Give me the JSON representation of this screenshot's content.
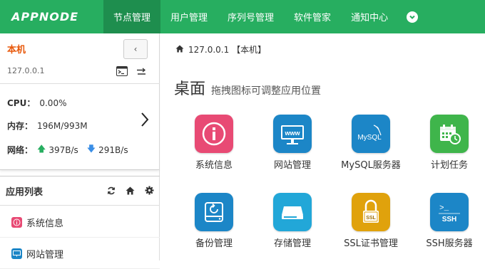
{
  "brand": "APPNODE",
  "nav": {
    "items": [
      "节点管理",
      "用户管理",
      "序列号管理",
      "软件管家",
      "通知中心"
    ],
    "active_index": 0
  },
  "sidebar": {
    "host_name": "本机",
    "host_ip": "127.0.0.1",
    "collapse_symbol": "‹",
    "cpu_label": "CPU：",
    "cpu_value": "0.00%",
    "mem_label": "内存：",
    "mem_value": "196M/993M",
    "net_label": "网络：",
    "net_up": "397B/s",
    "net_down": "291B/s",
    "app_list_title": "应用列表",
    "apps": [
      {
        "label": "系统信息",
        "icon": "info-icon",
        "color": "#e84a74"
      },
      {
        "label": "网站管理",
        "icon": "www-icon",
        "color": "#1c86c7"
      }
    ]
  },
  "main": {
    "breadcrumb_host": "127.0.0.1 【本机】",
    "desk_title": "桌面",
    "desk_subtitle": "拖拽图标可调整应用位置",
    "tiles": [
      {
        "label": "系统信息",
        "icon": "info-icon",
        "color": "#e84a74"
      },
      {
        "label": "网站管理",
        "icon": "www-icon",
        "color": "#1c86c7",
        "text": "www"
      },
      {
        "label": "MySQL服务器",
        "icon": "mysql-icon",
        "color": "#1c86c7",
        "text": "MySQL"
      },
      {
        "label": "计划任务",
        "icon": "calendar-icon",
        "color": "#3fb54b"
      },
      {
        "label": "备份管理",
        "icon": "backup-icon",
        "color": "#1c86c7"
      },
      {
        "label": "存储管理",
        "icon": "storage-icon",
        "color": "#22a7d8"
      },
      {
        "label": "SSL证书管理",
        "icon": "ssl-lock-icon",
        "color": "#e0a20c",
        "text": "SSL"
      },
      {
        "label": "SSH服务器",
        "icon": "ssh-icon",
        "color": "#1c86c7",
        "text": "SSH",
        "prompt": ">_"
      }
    ]
  },
  "colors": {
    "brand_green": "#27ae60",
    "host_orange": "#e8590c"
  }
}
